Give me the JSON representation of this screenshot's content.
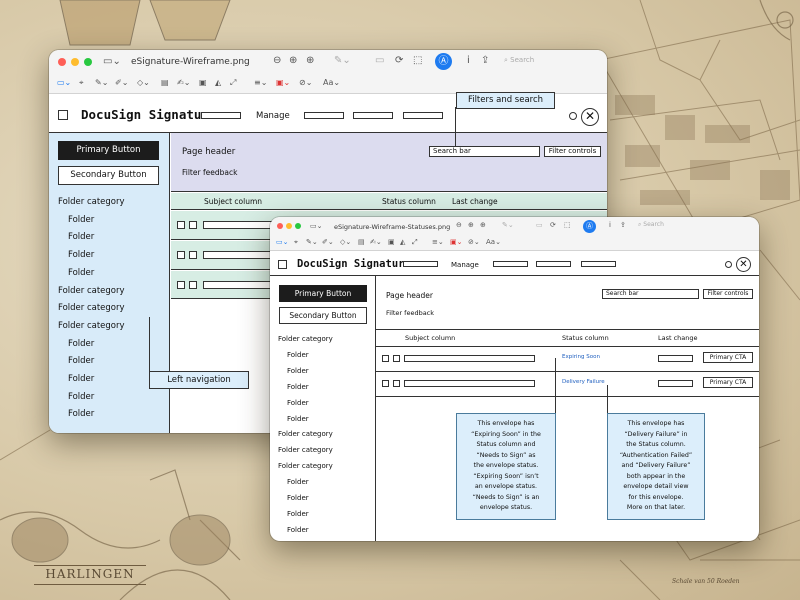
{
  "background": {
    "label": "HARLINGEN",
    "corner_text": "Schale van 50 Roeden"
  },
  "window_back": {
    "filename": "eSignature-Wireframe.png",
    "search_placeholder": "Search",
    "toolbar_icons": [
      "sidebar-icon",
      "zoom-out-icon",
      "zoom-in-icon",
      "share-icon",
      "pen-icon",
      "rotate-icon",
      "markup-icon",
      "info-icon"
    ],
    "wireframe": {
      "app_title": "DocuSign Signature",
      "manage_label": "Manage",
      "primary_button": "Primary Button",
      "secondary_button": "Secondary Button",
      "page_header": "Page header",
      "search_bar": "Search bar",
      "filter_controls": "Filter controls",
      "filter_feedback": "Filter feedback",
      "columns": [
        "Subject column",
        "Status column",
        "Last change"
      ],
      "nav": [
        {
          "label": "Folder category",
          "level": 0
        },
        {
          "label": "Folder",
          "level": 1
        },
        {
          "label": "Folder",
          "level": 1
        },
        {
          "label": "Folder",
          "level": 1
        },
        {
          "label": "Folder",
          "level": 1
        },
        {
          "label": "Folder category",
          "level": 0
        },
        {
          "label": "Folder category",
          "level": 0
        },
        {
          "label": "Folder category",
          "level": 0
        },
        {
          "label": "Folder",
          "level": 1
        },
        {
          "label": "Folder",
          "level": 1
        },
        {
          "label": "Folder",
          "level": 1
        },
        {
          "label": "Folder",
          "level": 1
        },
        {
          "label": "Folder",
          "level": 1
        }
      ],
      "callout_filters": "Filters and search",
      "callout_nav": "Left navigation"
    }
  },
  "window_front": {
    "filename": "eSignature-Wireframe-Statuses.png",
    "search_placeholder": "Search",
    "wireframe": {
      "app_title": "DocuSign Signature",
      "manage_label": "Manage",
      "primary_button": "Primary Button",
      "secondary_button": "Secondary Button",
      "page_header": "Page header",
      "search_bar": "Search bar",
      "filter_controls": "Filter controls",
      "filter_feedback": "Filter feedback",
      "columns": [
        "Subject column",
        "Status column",
        "Last change"
      ],
      "rows": [
        {
          "status": "Expiring Soon",
          "cta": "Primary CTA"
        },
        {
          "status": "Delivery Failure",
          "cta": "Primary CTA"
        }
      ],
      "nav": [
        {
          "label": "Folder category",
          "level": 0
        },
        {
          "label": "Folder",
          "level": 1
        },
        {
          "label": "Folder",
          "level": 1
        },
        {
          "label": "Folder",
          "level": 1
        },
        {
          "label": "Folder",
          "level": 1
        },
        {
          "label": "Folder",
          "level": 1
        },
        {
          "label": "Folder category",
          "level": 0
        },
        {
          "label": "Folder category",
          "level": 0
        },
        {
          "label": "Folder category",
          "level": 0
        },
        {
          "label": "Folder",
          "level": 1
        },
        {
          "label": "Folder",
          "level": 1
        },
        {
          "label": "Folder",
          "level": 1
        },
        {
          "label": "Folder",
          "level": 1
        },
        {
          "label": "Folder",
          "level": 1
        }
      ],
      "note_left": [
        "This envelope has",
        "“Expiring Soon” in the",
        "Status column and",
        "“Needs to Sign” as",
        "the envelope status.",
        "“Expiring Soon” isn’t",
        "an envelope status.",
        "“Needs to Sign” is an",
        "envelope status."
      ],
      "note_right": [
        "This envelope has",
        "“Delivery Failure” in",
        "the Status column.",
        "“Authentication Failed”",
        "and “Delivery Failure”",
        "both appear in the",
        "envelope detail view",
        "for this envelope.",
        "More on that later."
      ]
    }
  },
  "colors": {
    "nav_bg": "#d8ebf9",
    "header_bg": "#dcdcef",
    "col_header_bg": "#d7ede4",
    "row_bg": "#d7ede4",
    "note_bg": "#dceefb",
    "status_link": "#1f5fbf",
    "accent": "#1e7bf0"
  }
}
